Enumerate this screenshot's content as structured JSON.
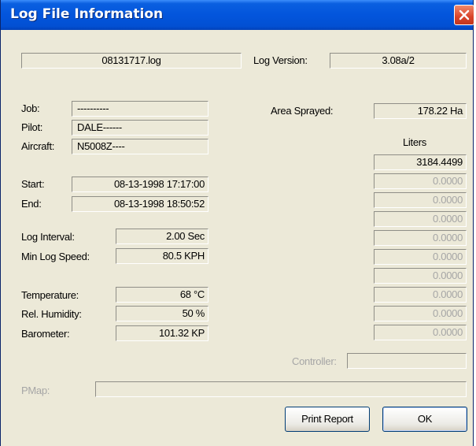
{
  "window": {
    "title": "Log File Information"
  },
  "file": {
    "name": "08131717.log",
    "version_label": "Log Version:",
    "version": "3.08a/2"
  },
  "job": {
    "label": "Job:",
    "value": "----------"
  },
  "pilot": {
    "label": "Pilot:",
    "value": "DALE------"
  },
  "aircraft": {
    "label": "Aircraft:",
    "value": "N5008Z----"
  },
  "start": {
    "label": "Start:",
    "value": "08-13-1998 17:17:00"
  },
  "end": {
    "label": "End:",
    "value": "08-13-1998 18:50:52"
  },
  "log_interval": {
    "label": "Log Interval:",
    "value": "2.00 Sec"
  },
  "min_log_speed": {
    "label": "Min Log Speed:",
    "value": "80.5 KPH"
  },
  "temperature": {
    "label": "Temperature:",
    "value": "68 °C"
  },
  "humidity": {
    "label": "Rel. Humidity:",
    "value": "50 %"
  },
  "barometer": {
    "label": "Barometer:",
    "value": "101.32 KP"
  },
  "area": {
    "label": "Area Sprayed:",
    "value": "178.22 Ha"
  },
  "liters": {
    "header": "Liters",
    "values": [
      "3184.4499",
      "0.0000",
      "0.0000",
      "0.0000",
      "0.0000",
      "0.0000",
      "0.0000",
      "0.0000",
      "0.0000",
      "0.0000"
    ]
  },
  "controller": {
    "label": "Controller:",
    "value": ""
  },
  "pmap": {
    "label": "PMap:",
    "value": ""
  },
  "buttons": {
    "print": "Print Report",
    "ok": "OK"
  },
  "colors": {
    "titlebar": "#0355dc",
    "dialog": "#ece9d8",
    "close": "#d9442a",
    "disabled_text": "#a6a6a6"
  },
  "icons": {
    "close": "close-icon"
  }
}
